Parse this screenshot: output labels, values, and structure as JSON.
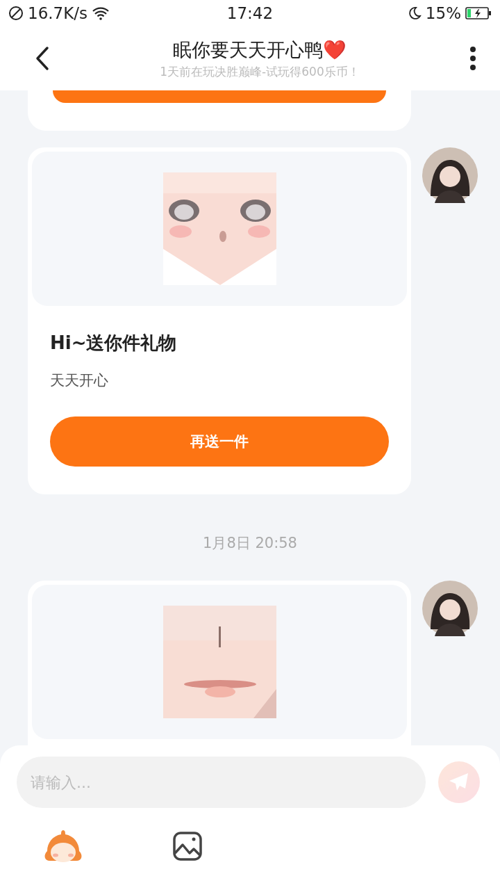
{
  "status_bar": {
    "speed": "16.7K/s",
    "time": "17:42",
    "battery": "15%"
  },
  "header": {
    "title": "眠你要天天开心鸭❤️",
    "subtitle": "1天前在玩决胜巅峰-试玩得600乐币！"
  },
  "messages": [
    {
      "kind": "cut_card"
    },
    {
      "kind": "gift",
      "title": "Hi~送你件礼物",
      "text": "天天开心",
      "button": "再送一件"
    },
    {
      "kind": "time",
      "text": "1月8日 20:58"
    },
    {
      "kind": "gift"
    }
  ],
  "composer": {
    "placeholder": "请输入...",
    "send_disabled": true
  }
}
